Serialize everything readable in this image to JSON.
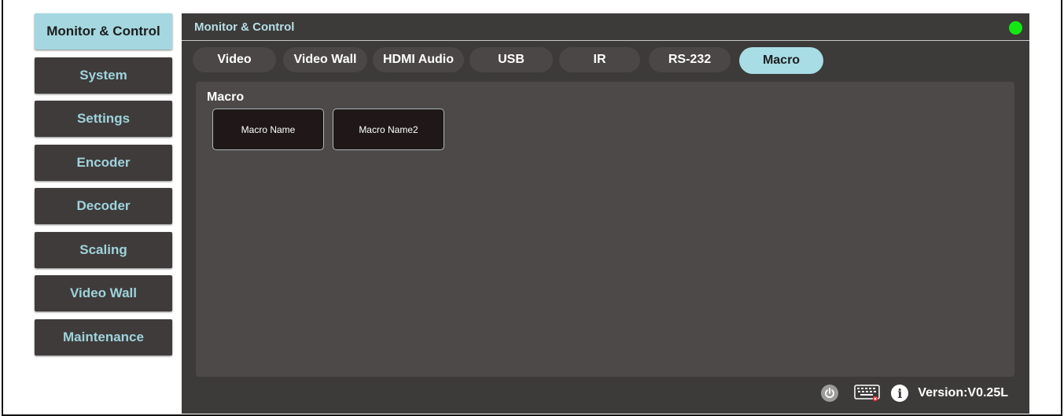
{
  "sidebar": {
    "items": [
      {
        "label": "Monitor & Control",
        "active": true
      },
      {
        "label": "System"
      },
      {
        "label": "Settings"
      },
      {
        "label": "Encoder"
      },
      {
        "label": "Decoder"
      },
      {
        "label": "Scaling"
      },
      {
        "label": "Video Wall"
      },
      {
        "label": "Maintenance"
      }
    ]
  },
  "panel": {
    "title": "Monitor & Control",
    "status_color": "#12e812"
  },
  "tabs": [
    {
      "label": "Video"
    },
    {
      "label": "Video Wall"
    },
    {
      "label": "HDMI Audio"
    },
    {
      "label": "USB"
    },
    {
      "label": "IR"
    },
    {
      "label": "RS-232"
    },
    {
      "label": "Macro",
      "active": true
    }
  ],
  "content": {
    "title": "Macro",
    "macros": [
      "Macro Name",
      "Macro Name2"
    ]
  },
  "footer": {
    "power_icon": "power-icon",
    "keyboard_icon": "keyboard-icon",
    "info_icon": "info-icon",
    "info_glyph": "i",
    "version": "Version:V0.25L"
  },
  "colors": {
    "accent": "#a8dde5",
    "panel_bg": "#3d3a3a",
    "sidebar_text": "#9fd3dc"
  }
}
